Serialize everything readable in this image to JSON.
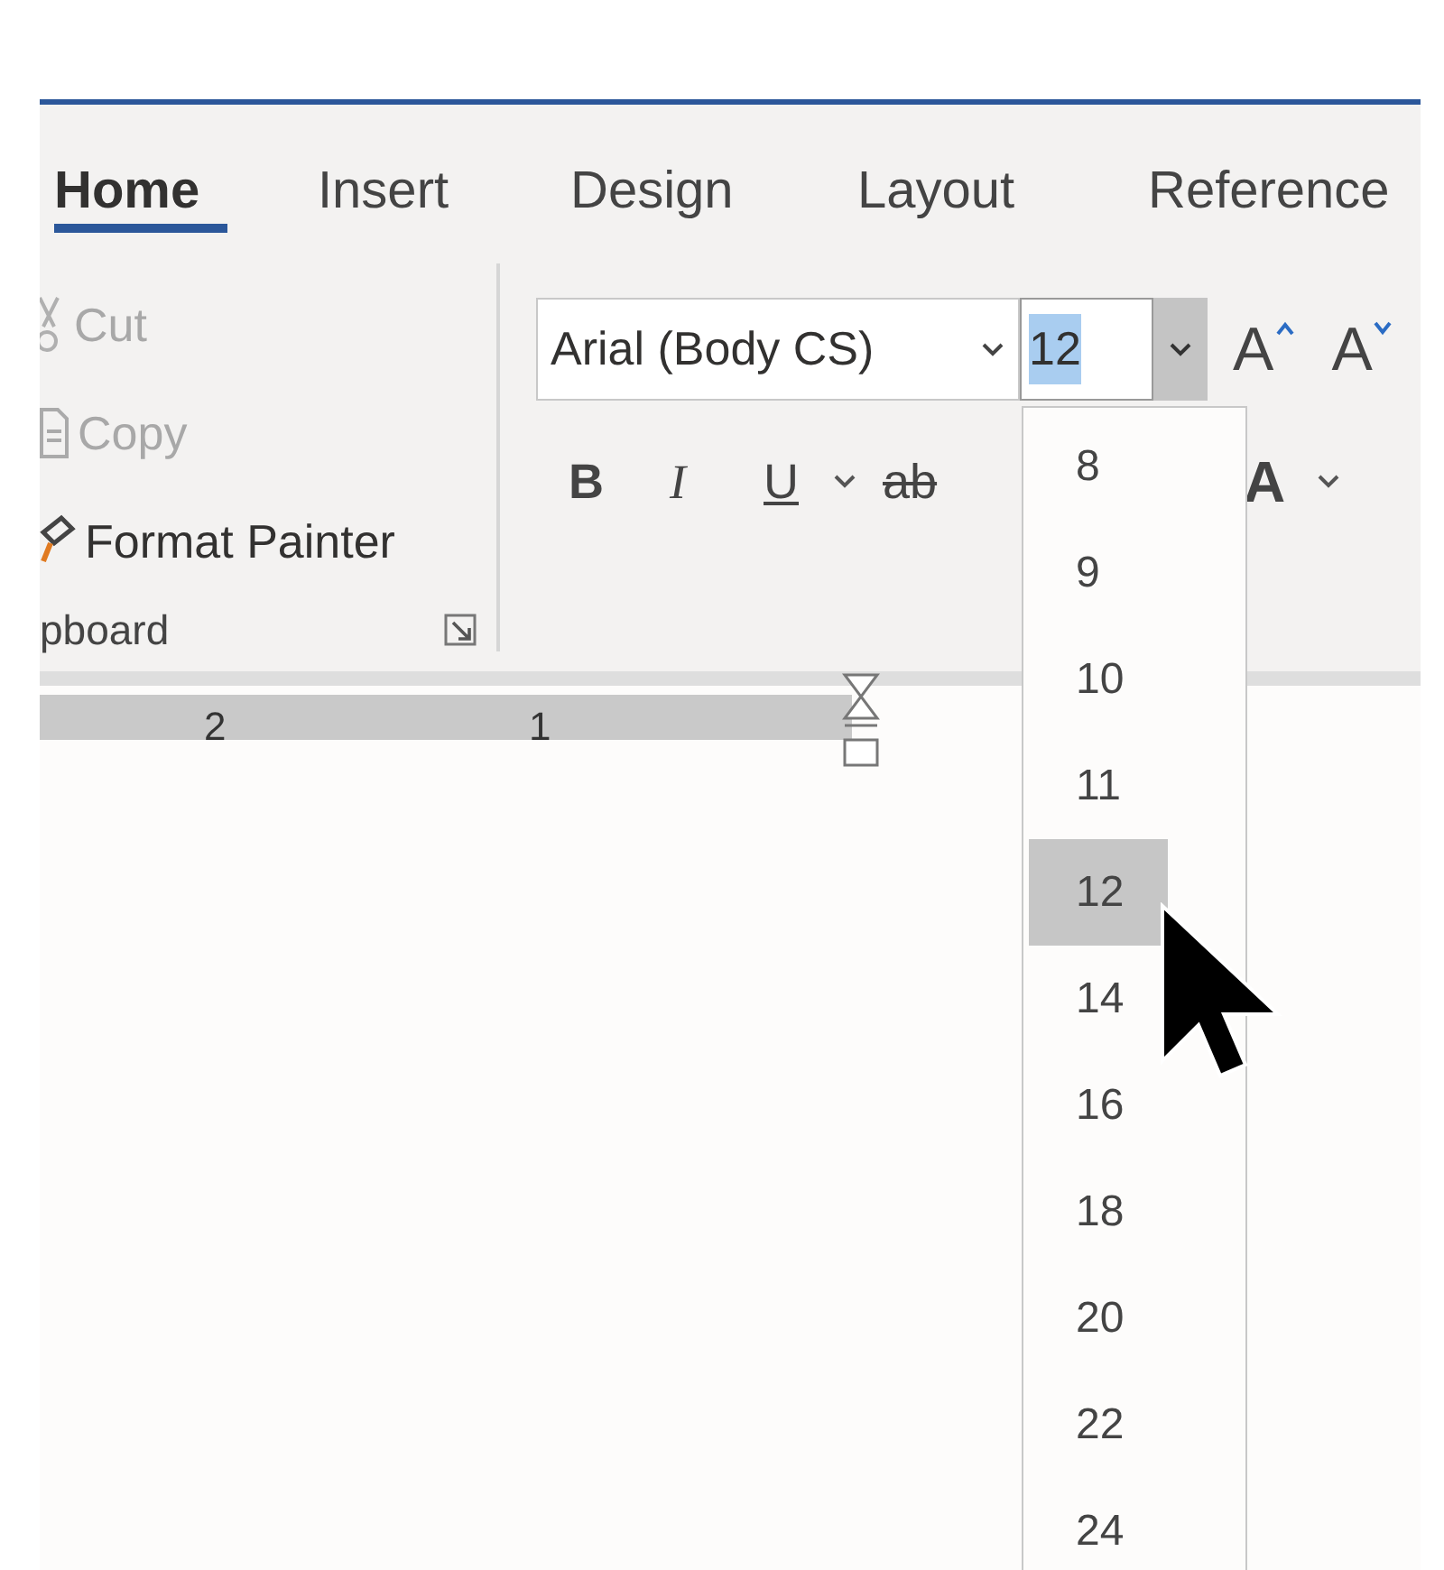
{
  "tabs": [
    {
      "label": "Home",
      "selected": true
    },
    {
      "label": "Insert",
      "selected": false
    },
    {
      "label": "Design",
      "selected": false
    },
    {
      "label": "Layout",
      "selected": false
    },
    {
      "label": "Reference",
      "selected": false
    }
  ],
  "clipboard": {
    "items": [
      {
        "kind": "cut",
        "label": "Cut",
        "disabled": true
      },
      {
        "kind": "copy",
        "label": "Copy",
        "disabled": true
      },
      {
        "kind": "painter",
        "label": "Format Painter",
        "disabled": false
      }
    ],
    "group_label": "pboard"
  },
  "font": {
    "name": "Arial (Body CS)",
    "size": "12",
    "size_text_selected": true,
    "grow_label": "A",
    "shrink_label": "A"
  },
  "format_buttons": [
    {
      "kind": "bold",
      "label": "B"
    },
    {
      "kind": "italic",
      "label": "I"
    },
    {
      "kind": "underline",
      "label": "U"
    },
    {
      "kind": "strike",
      "label": "ab"
    },
    {
      "kind": "effects",
      "label": "A"
    }
  ],
  "ruler": {
    "labels": [
      "2",
      "1"
    ]
  },
  "size_dropdown": {
    "options": [
      {
        "label": "8",
        "selected": false
      },
      {
        "label": "9",
        "selected": false
      },
      {
        "label": "10",
        "selected": false
      },
      {
        "label": "11",
        "selected": false
      },
      {
        "label": "12",
        "selected": true
      },
      {
        "label": "14",
        "selected": false
      },
      {
        "label": "16",
        "selected": false
      },
      {
        "label": "18",
        "selected": false
      },
      {
        "label": "20",
        "selected": false
      },
      {
        "label": "22",
        "selected": false
      },
      {
        "label": "24",
        "selected": false
      }
    ]
  }
}
